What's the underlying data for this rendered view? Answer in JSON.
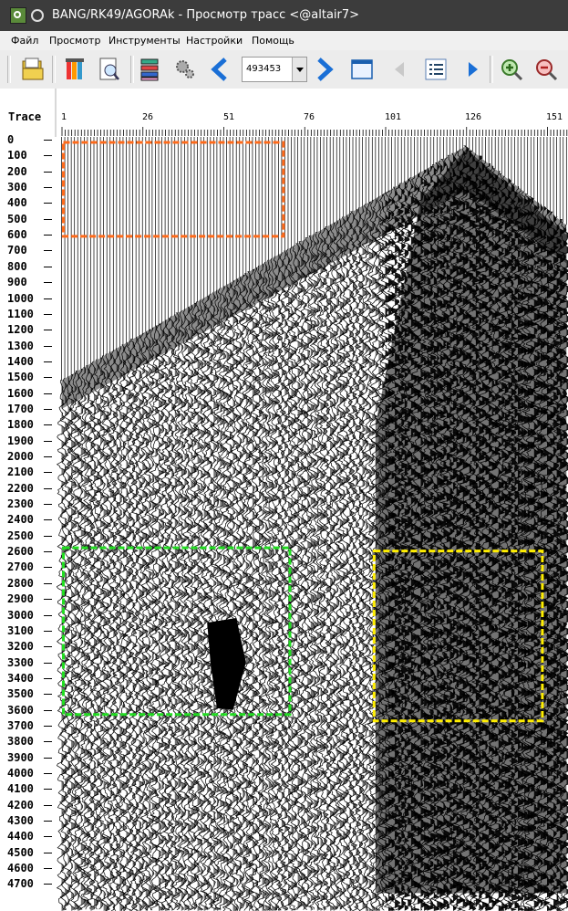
{
  "window": {
    "title": "BANG/RK49/AGORAk - Просмотр трасс <@altair7>"
  },
  "menu": [
    "Файл",
    "Просмотр",
    "Инструменты",
    "Настройки",
    "Помощь"
  ],
  "toolbar": {
    "trace_value": "493453"
  },
  "axes": {
    "corner_label": "Trace",
    "x_ticks": [
      "1",
      "26",
      "51",
      "76",
      "101",
      "126",
      "151"
    ],
    "y_ticks": [
      "0",
      "100",
      "200",
      "300",
      "400",
      "500",
      "600",
      "700",
      "800",
      "900",
      "1000",
      "1100",
      "1200",
      "1300",
      "1400",
      "1500",
      "1600",
      "1700",
      "1800",
      "1900",
      "2000",
      "2100",
      "2200",
      "2300",
      "2400",
      "2500",
      "2600",
      "2700",
      "2800",
      "2900",
      "3000",
      "3100",
      "3200",
      "3300",
      "3400",
      "3500",
      "3600",
      "3700",
      "3800",
      "3900",
      "4000",
      "4100",
      "4200",
      "4300",
      "4400",
      "4500",
      "4600",
      "4700"
    ]
  },
  "colors": {
    "orange_box": "#ff6a1a",
    "green_box": "#22dd22",
    "yellow_box": "#ffee00"
  },
  "annotations": [
    {
      "name": "orange-box",
      "color": "#ff6a1a",
      "trace_start": 1,
      "trace_end": 69,
      "time_start": 0,
      "time_end": 610
    },
    {
      "name": "green-box",
      "color": "#22dd22",
      "trace_start": 1,
      "trace_end": 71,
      "time_start": 2560,
      "time_end": 3630
    },
    {
      "name": "yellow-box",
      "color": "#ffee00",
      "trace_start": 97,
      "trace_end": 149,
      "time_start": 2580,
      "time_end": 3670
    }
  ]
}
